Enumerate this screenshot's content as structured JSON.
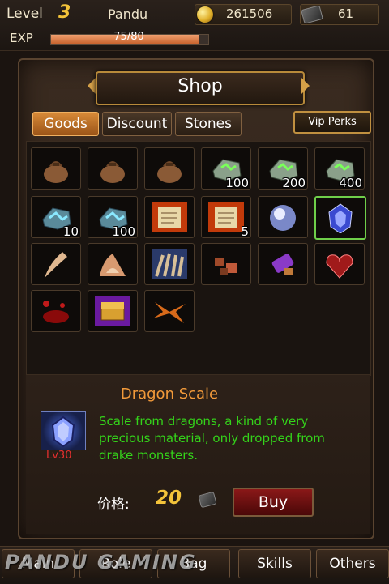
{
  "player": {
    "level_label": "Level",
    "level": "3",
    "name": "Pandu",
    "gold": "261506",
    "gems": "61",
    "exp_label": "EXP",
    "exp_text": "75/80",
    "exp_fraction": 0.9375
  },
  "shop": {
    "title": "Shop",
    "tabs": [
      "Goods",
      "Discount",
      "Stones"
    ],
    "active_tab": "Goods",
    "vip_label": "Vip Perks"
  },
  "items": [
    {
      "icon": "sack-icon",
      "qty": ""
    },
    {
      "icon": "sack-icon",
      "qty": ""
    },
    {
      "icon": "sack-icon",
      "qty": ""
    },
    {
      "icon": "green-rune-stone-icon",
      "qty": "100"
    },
    {
      "icon": "green-rune-stone-icon",
      "qty": "200"
    },
    {
      "icon": "green-rune-stone-icon",
      "qty": "400"
    },
    {
      "icon": "blue-rune-stone-icon",
      "qty": "10"
    },
    {
      "icon": "blue-rune-stone-icon",
      "qty": "100"
    },
    {
      "icon": "fire-scroll-icon",
      "qty": ""
    },
    {
      "icon": "fire-scroll-icon",
      "qty": "5"
    },
    {
      "icon": "pearl-orb-icon",
      "qty": ""
    },
    {
      "icon": "dragon-scale-icon",
      "qty": ""
    },
    {
      "icon": "fang-icon",
      "qty": ""
    },
    {
      "icon": "bone-claw-icon",
      "qty": ""
    },
    {
      "icon": "claw-icon",
      "qty": ""
    },
    {
      "icon": "ore-chunks-icon",
      "qty": ""
    },
    {
      "icon": "purple-vial-icon",
      "qty": ""
    },
    {
      "icon": "heart-icon",
      "qty": ""
    },
    {
      "icon": "blood-splash-icon",
      "qty": ""
    },
    {
      "icon": "treasure-chest-icon",
      "qty": ""
    },
    {
      "icon": "feather-wing-icon",
      "qty": ""
    }
  ],
  "selected": {
    "name": "Dragon Scale",
    "level": "Lv30",
    "description": "Scale from dragons, a kind of very precious material, only dropped from drake monsters.",
    "price_label": "价格:",
    "price": "20",
    "buy_label": "Buy"
  },
  "nav": [
    "Main",
    "Role",
    "Bag",
    "Skills",
    "Others"
  ],
  "watermark": "PANDU GAMING"
}
